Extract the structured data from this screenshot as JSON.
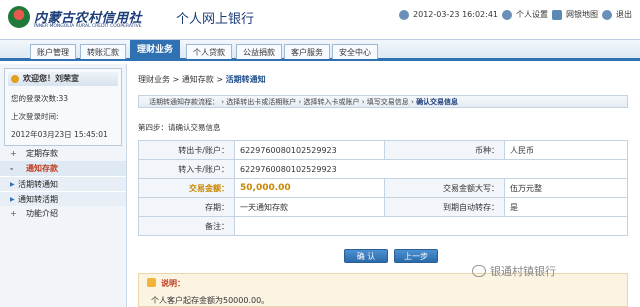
{
  "header": {
    "bank_name_cn": "内蒙古农村信用社",
    "bank_name_en": "INNER MONGOLIA RURAL CREDIT COOPERATIVE",
    "site_name": "个人网上银行",
    "datetime": "2012-03-23 16:02:41",
    "links": [
      "个人设置",
      "网银地图",
      "退出"
    ]
  },
  "nav": {
    "items": [
      "账户管理",
      "转账汇款",
      "理财业务",
      "个人贷款",
      "公益捐款",
      "客户服务",
      "安全中心"
    ],
    "active": "理财业务"
  },
  "user": {
    "welcome": "欢迎您！刘荣宣",
    "login_count": "您的登录次数:33",
    "last_login_label": "上次登录时间:",
    "last_login_time": "2012年03月23日 15:45:01"
  },
  "menu": {
    "items": [
      {
        "label": "定期存款",
        "marker": "+"
      },
      {
        "label": "通知存款",
        "marker": "-"
      },
      {
        "label": "活期转通知"
      },
      {
        "label": "通知转活期"
      },
      {
        "label": "功能介绍",
        "marker": "+"
      }
    ]
  },
  "breadcrumb": {
    "part1": "理财业务 > 通知存款 > ",
    "current": "活期转通知"
  },
  "steps": {
    "prefix": "活期转通知存款流程：",
    "items": [
      "选择转出卡或活期账户",
      "选择转入卡或账户",
      "填写交易信息"
    ],
    "current": "确认交易信息"
  },
  "step_label": "第四步：请确认交易信息",
  "form": {
    "from_label": "转出卡/账户：",
    "from_value": "6229760080102529923",
    "currency_label": "币种：",
    "currency_value": "人民币",
    "to_label": "转入卡/账户：",
    "to_value": "6229760080102529923",
    "amount_label": "交易金额：",
    "amount_value": "50,000.00",
    "amount_cn_label": "交易金额大写：",
    "amount_cn_value": "伍万元整",
    "term_label": "存期：",
    "term_value": "一天通知存款",
    "auto_label": "到期自动转存：",
    "auto_value": "是",
    "remark_label": "备注：",
    "remark_value": ""
  },
  "buttons": {
    "confirm": "确 认",
    "back": "上一步"
  },
  "notice": {
    "title": "说明：",
    "text": "个人客户起存金额为50000.00。"
  },
  "watermark": "银通村镇银行"
}
